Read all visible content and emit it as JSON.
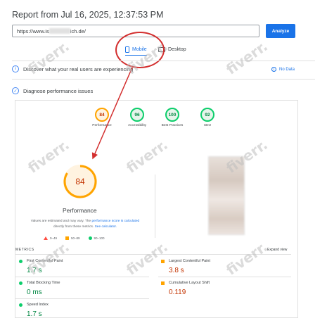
{
  "report": {
    "title": "Report from Jul 16, 2025, 12:37:53 PM",
    "url_prefix": "https://www.is",
    "url_suffix": "ich.de/",
    "analyze_label": "Analyze"
  },
  "device_tabs": [
    {
      "label": "Mobile",
      "active": true,
      "icon": "phone-icon"
    },
    {
      "label": "Desktop",
      "active": false,
      "icon": "monitor-icon"
    }
  ],
  "sections": {
    "field_data": "Discover what your real users are experiencing",
    "no_data": "No Data",
    "lab_data": "Diagnose performance issues"
  },
  "scores": [
    {
      "label": "Performance",
      "value": "84",
      "color": "#ffa400"
    },
    {
      "label": "Accessibility",
      "value": "96",
      "color": "#0cce6b"
    },
    {
      "label": "Best Practices",
      "value": "100",
      "color": "#0cce6b"
    },
    {
      "label": "SEO",
      "value": "92",
      "color": "#0cce6b"
    }
  ],
  "main_score": {
    "value": "84",
    "label": "Performance",
    "fraction": 0.84,
    "color": "#ffa400"
  },
  "disclaimer": {
    "text": "Values are estimated and may vary. The",
    "link1": "performance score is calculated",
    "text2": "directly from these metrics.",
    "link2": "See calculator."
  },
  "legend": [
    "0–49",
    "50–89",
    "90–100"
  ],
  "metrics_header": "METRICS",
  "expand_label": "Expand view",
  "metrics": [
    {
      "label": "First Contentful Paint",
      "value": "1.7 s",
      "status": "good"
    },
    {
      "label": "Largest Contentful Paint",
      "value": "3.8 s",
      "status": "average"
    },
    {
      "label": "Total Blocking Time",
      "value": "0 ms",
      "status": "good"
    },
    {
      "label": "Cumulative Layout Shift",
      "value": "0.119",
      "status": "average"
    },
    {
      "label": "Speed Index",
      "value": "1.7 s",
      "status": "good"
    }
  ],
  "watermark": "fiverr.",
  "colors": {
    "accent": "#1a73e8",
    "good": "#0cce6b",
    "average": "#ffa400",
    "poor": "#ff4e42",
    "annotation": "#d32f2f"
  }
}
